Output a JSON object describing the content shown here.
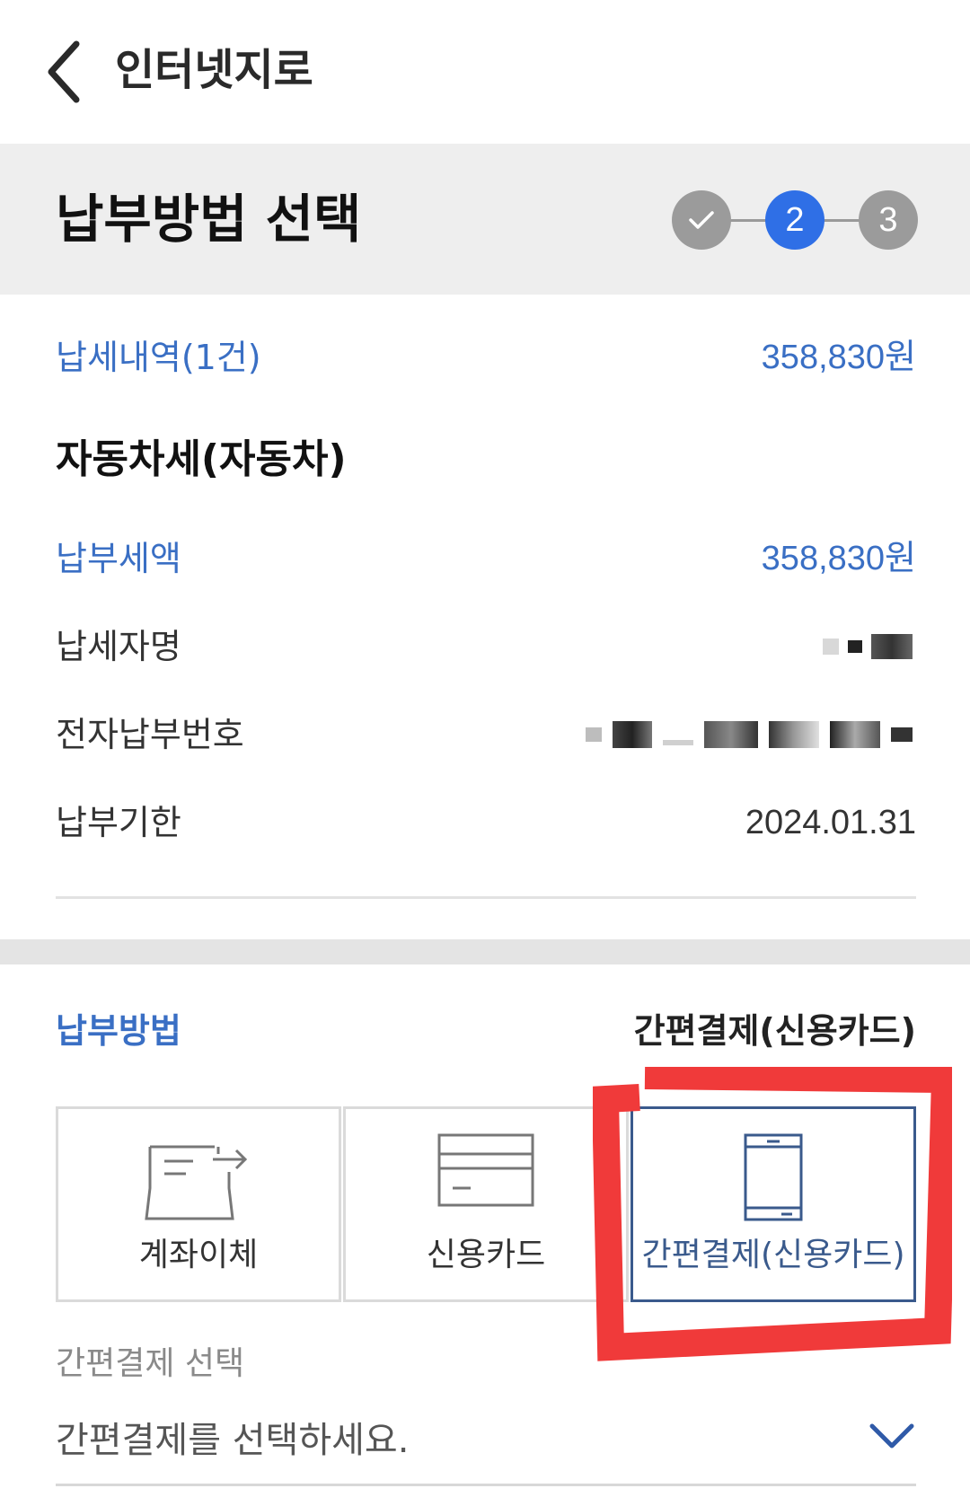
{
  "header": {
    "title": "인터넷지로"
  },
  "step": {
    "title": "납부방법 선택",
    "steps": [
      "✓",
      "2",
      "3"
    ],
    "current": 2
  },
  "summary": {
    "count_label": "납세내역(1건)",
    "count_total": "358,830원",
    "tax_title": "자동차세(자동차)",
    "amount_label": "납부세액",
    "amount_value": "358,830원",
    "payer_label": "납세자명",
    "epay_label": "전자납부번호",
    "due_label": "납부기한",
    "due_value": "2024.01.31"
  },
  "payment": {
    "label": "납부방법",
    "selected": "간편결제(신용카드)",
    "options": [
      {
        "label": "계좌이체",
        "icon": "bank-transfer-icon"
      },
      {
        "label": "신용카드",
        "icon": "credit-card-icon"
      },
      {
        "label": "간편결제(신용카드)",
        "icon": "mobile-phone-icon"
      }
    ],
    "simple_pay_label": "간편결제 선택",
    "simple_pay_placeholder": "간편결제를 선택하세요."
  },
  "colors": {
    "accent_blue": "#2f6fe6",
    "label_blue": "#3a6fc4",
    "selected_border": "#3a5a8c",
    "highlight_red": "#f03a3a",
    "step_gray": "#9b9b9b",
    "band_gray": "#eeeeee"
  }
}
